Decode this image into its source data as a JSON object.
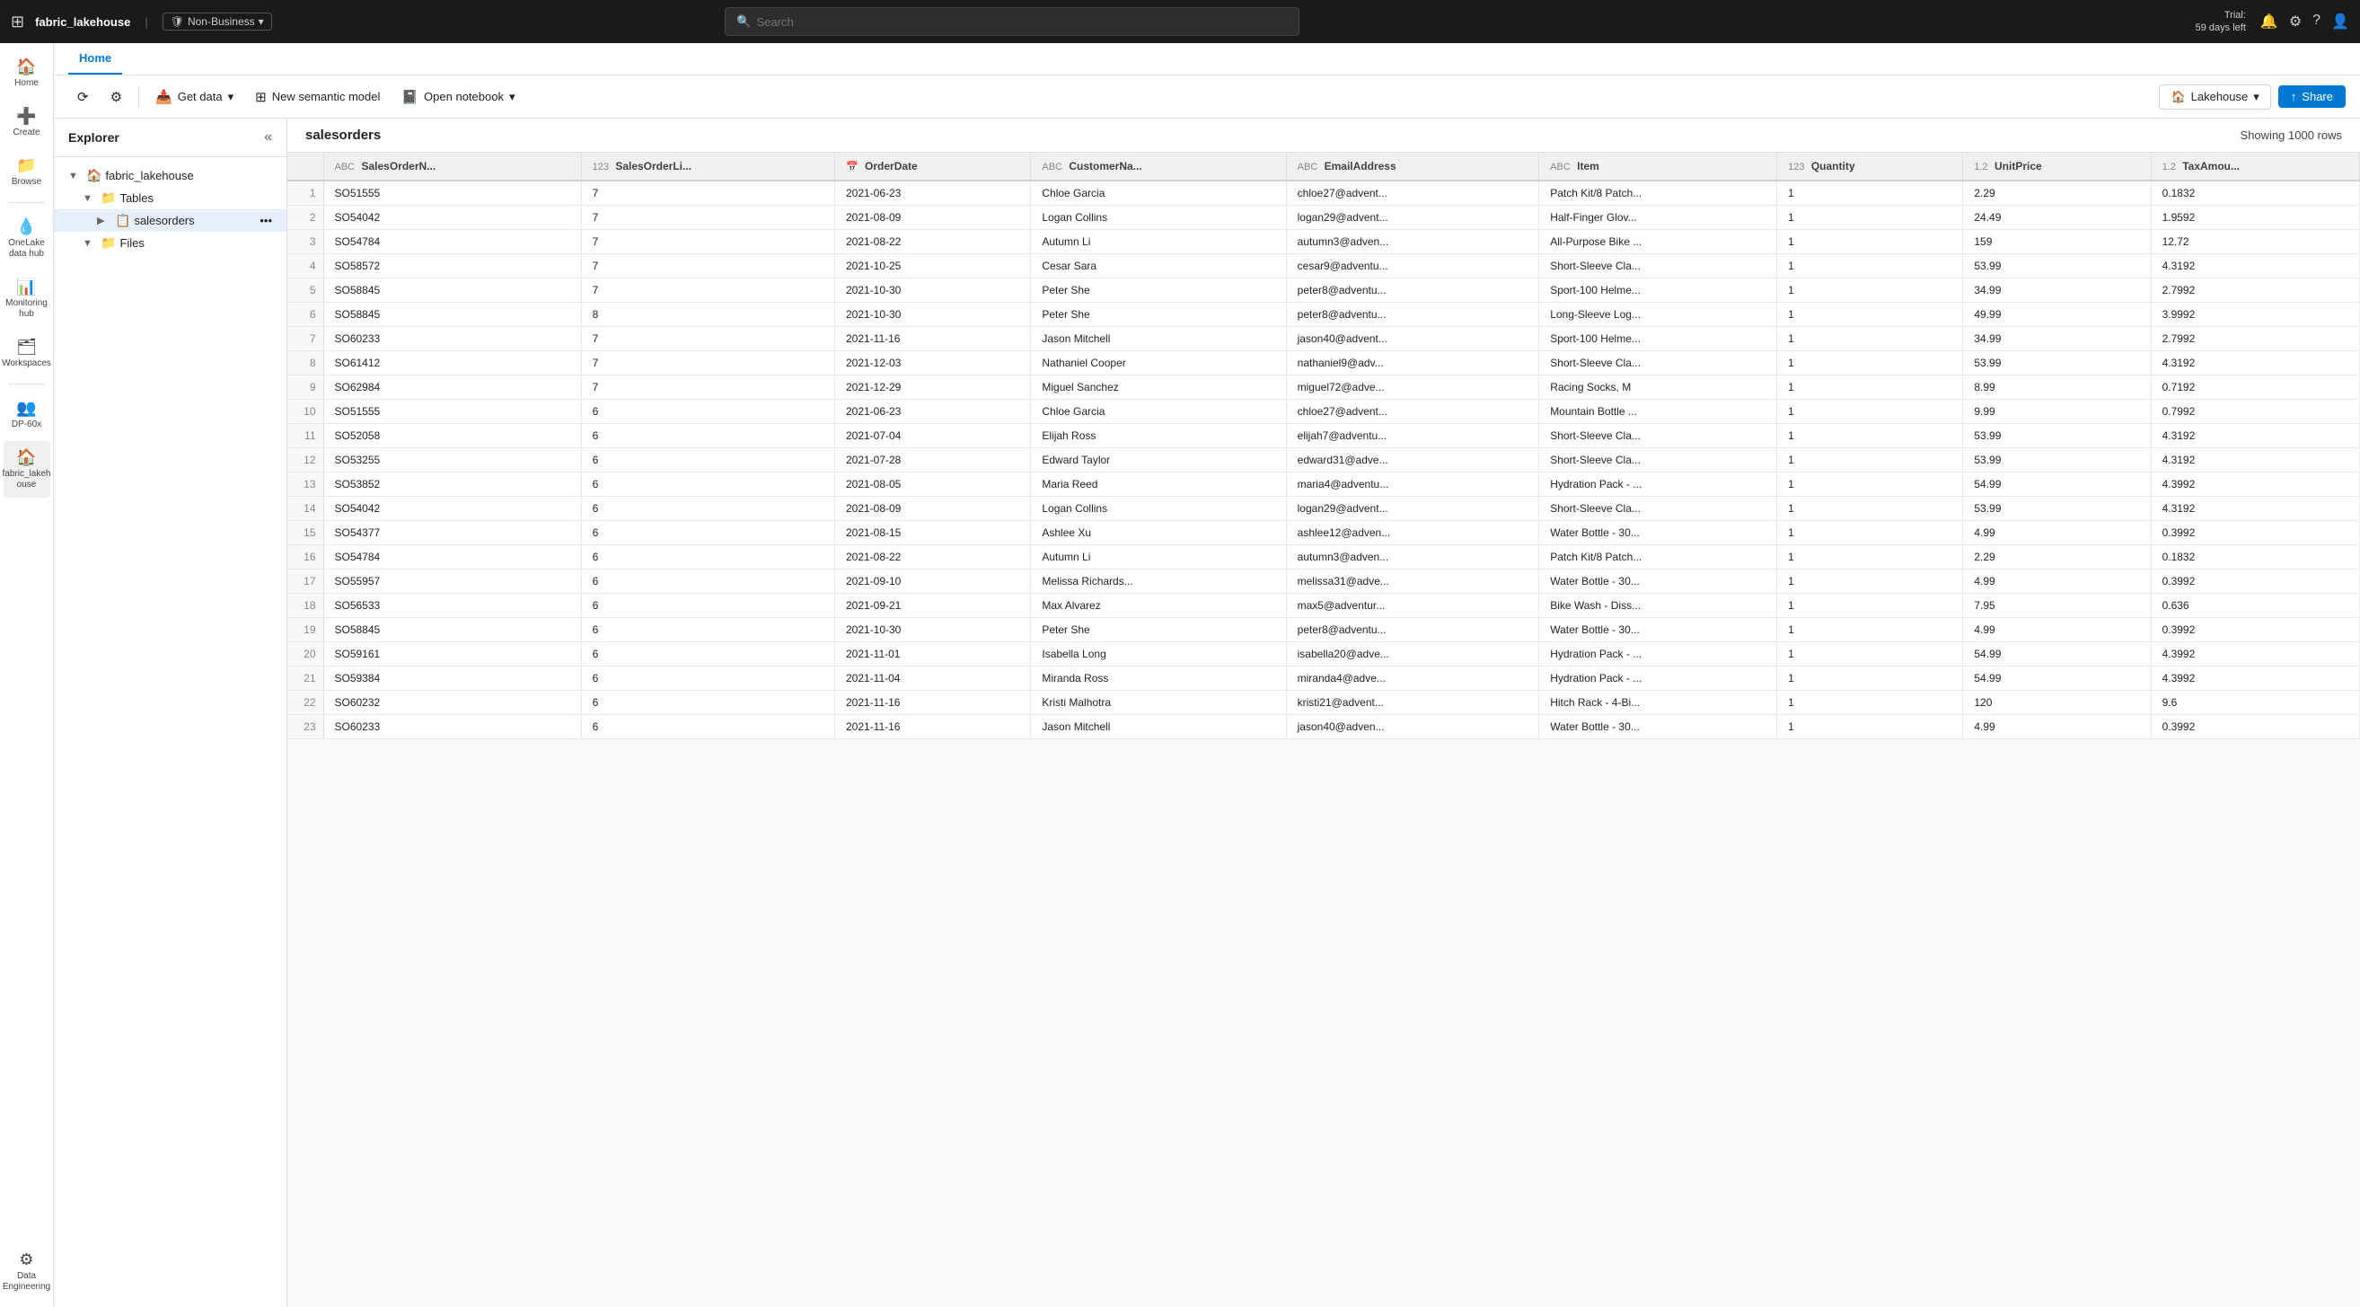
{
  "app": {
    "name": "fabric_lakehouse",
    "badge_icon": "🛡",
    "badge_label": "Non-Business",
    "trial_line1": "Trial:",
    "trial_line2": "59 days left"
  },
  "search": {
    "placeholder": "Search"
  },
  "topbar_icons": [
    "🔔",
    "⚙",
    "?",
    "👤"
  ],
  "tabs": {
    "active": "Home",
    "items": [
      "Home"
    ]
  },
  "toolbar": {
    "get_data_label": "Get data",
    "new_semantic_model_label": "New semantic model",
    "open_notebook_label": "Open notebook",
    "lakehouse_label": "Lakehouse",
    "share_label": "Share"
  },
  "explorer": {
    "title": "Explorer",
    "root": {
      "label": "fabric_lakehouse",
      "children": [
        {
          "label": "Tables",
          "children": [
            {
              "label": "salesorders",
              "active": true
            }
          ]
        },
        {
          "label": "Files",
          "children": []
        }
      ]
    }
  },
  "data_view": {
    "table_name": "salesorders",
    "rows_info": "Showing 1000 rows",
    "columns": [
      {
        "type": "ABC",
        "name": "SalesOrderN..."
      },
      {
        "type": "123",
        "name": "SalesOrderLi..."
      },
      {
        "type": "📅",
        "name": "OrderDate"
      },
      {
        "type": "ABC",
        "name": "CustomerNa..."
      },
      {
        "type": "ABC",
        "name": "EmailAddress"
      },
      {
        "type": "ABC",
        "name": "Item"
      },
      {
        "type": "123",
        "name": "Quantity"
      },
      {
        "type": "1.2",
        "name": "UnitPrice"
      },
      {
        "type": "1.2",
        "name": "TaxAmou..."
      }
    ],
    "rows": [
      [
        1,
        "SO51555",
        "7",
        "2021-06-23",
        "Chloe Garcia",
        "chloe27@advent...",
        "Patch Kit/8 Patch...",
        "1",
        "2.29",
        "0.1832"
      ],
      [
        2,
        "SO54042",
        "7",
        "2021-08-09",
        "Logan Collins",
        "logan29@advent...",
        "Half-Finger Glov...",
        "1",
        "24.49",
        "1.9592"
      ],
      [
        3,
        "SO54784",
        "7",
        "2021-08-22",
        "Autumn Li",
        "autumn3@adven...",
        "All-Purpose Bike ...",
        "1",
        "159",
        "12.72"
      ],
      [
        4,
        "SO58572",
        "7",
        "2021-10-25",
        "Cesar Sara",
        "cesar9@adventu...",
        "Short-Sleeve Cla...",
        "1",
        "53.99",
        "4.3192"
      ],
      [
        5,
        "SO58845",
        "7",
        "2021-10-30",
        "Peter She",
        "peter8@adventu...",
        "Sport-100 Helme...",
        "1",
        "34.99",
        "2.7992"
      ],
      [
        6,
        "SO58845",
        "8",
        "2021-10-30",
        "Peter She",
        "peter8@adventu...",
        "Long-Sleeve Log...",
        "1",
        "49.99",
        "3.9992"
      ],
      [
        7,
        "SO60233",
        "7",
        "2021-11-16",
        "Jason Mitchell",
        "jason40@advent...",
        "Sport-100 Helme...",
        "1",
        "34.99",
        "2.7992"
      ],
      [
        8,
        "SO61412",
        "7",
        "2021-12-03",
        "Nathaniel Cooper",
        "nathaniel9@adv...",
        "Short-Sleeve Cla...",
        "1",
        "53.99",
        "4.3192"
      ],
      [
        9,
        "SO62984",
        "7",
        "2021-12-29",
        "Miguel Sanchez",
        "miguel72@adve...",
        "Racing Socks, M",
        "1",
        "8.99",
        "0.7192"
      ],
      [
        10,
        "SO51555",
        "6",
        "2021-06-23",
        "Chloe Garcia",
        "chloe27@advent...",
        "Mountain Bottle ...",
        "1",
        "9.99",
        "0.7992"
      ],
      [
        11,
        "SO52058",
        "6",
        "2021-07-04",
        "Elijah Ross",
        "elijah7@adventu...",
        "Short-Sleeve Cla...",
        "1",
        "53.99",
        "4.3192"
      ],
      [
        12,
        "SO53255",
        "6",
        "2021-07-28",
        "Edward Taylor",
        "edward31@adve...",
        "Short-Sleeve Cla...",
        "1",
        "53.99",
        "4.3192"
      ],
      [
        13,
        "SO53852",
        "6",
        "2021-08-05",
        "Maria Reed",
        "maria4@adventu...",
        "Hydration Pack - ...",
        "1",
        "54.99",
        "4.3992"
      ],
      [
        14,
        "SO54042",
        "6",
        "2021-08-09",
        "Logan Collins",
        "logan29@advent...",
        "Short-Sleeve Cla...",
        "1",
        "53.99",
        "4.3192"
      ],
      [
        15,
        "SO54377",
        "6",
        "2021-08-15",
        "Ashlee Xu",
        "ashlee12@adven...",
        "Water Bottle - 30...",
        "1",
        "4.99",
        "0.3992"
      ],
      [
        16,
        "SO54784",
        "6",
        "2021-08-22",
        "Autumn Li",
        "autumn3@adven...",
        "Patch Kit/8 Patch...",
        "1",
        "2.29",
        "0.1832"
      ],
      [
        17,
        "SO55957",
        "6",
        "2021-09-10",
        "Melissa Richards...",
        "melissa31@adve...",
        "Water Bottle - 30...",
        "1",
        "4.99",
        "0.3992"
      ],
      [
        18,
        "SO56533",
        "6",
        "2021-09-21",
        "Max Alvarez",
        "max5@adventur...",
        "Bike Wash - Diss...",
        "1",
        "7.95",
        "0.636"
      ],
      [
        19,
        "SO58845",
        "6",
        "2021-10-30",
        "Peter She",
        "peter8@adventu...",
        "Water Bottle - 30...",
        "1",
        "4.99",
        "0.3992"
      ],
      [
        20,
        "SO59161",
        "6",
        "2021-11-01",
        "Isabella Long",
        "isabella20@adve...",
        "Hydration Pack - ...",
        "1",
        "54.99",
        "4.3992"
      ],
      [
        21,
        "SO59384",
        "6",
        "2021-11-04",
        "Miranda Ross",
        "miranda4@adve...",
        "Hydration Pack - ...",
        "1",
        "54.99",
        "4.3992"
      ],
      [
        22,
        "SO60232",
        "6",
        "2021-11-16",
        "Kristi Malhotra",
        "kristi21@advent...",
        "Hitch Rack - 4-Bi...",
        "1",
        "120",
        "9.6"
      ],
      [
        23,
        "SO60233",
        "6",
        "2021-11-16",
        "Jason Mitchell",
        "jason40@adven...",
        "Water Bottle - 30...",
        "1",
        "4.99",
        "0.3992"
      ]
    ]
  },
  "nav_items": [
    {
      "id": "home",
      "icon": "🏠",
      "label": "Home"
    },
    {
      "id": "create",
      "icon": "➕",
      "label": "Create"
    },
    {
      "id": "browse",
      "icon": "📁",
      "label": "Browse"
    },
    {
      "id": "onelake",
      "icon": "💧",
      "label": "OneLake data hub"
    },
    {
      "id": "monitoring",
      "icon": "📊",
      "label": "Monitoring hub"
    },
    {
      "id": "workspaces",
      "icon": "🗂",
      "label": "Workspaces"
    },
    {
      "id": "dp60x",
      "icon": "👥",
      "label": "DP-60x"
    },
    {
      "id": "fabric_lh",
      "icon": "🏠",
      "label": "fabric_lakehouse",
      "active": true
    }
  ]
}
